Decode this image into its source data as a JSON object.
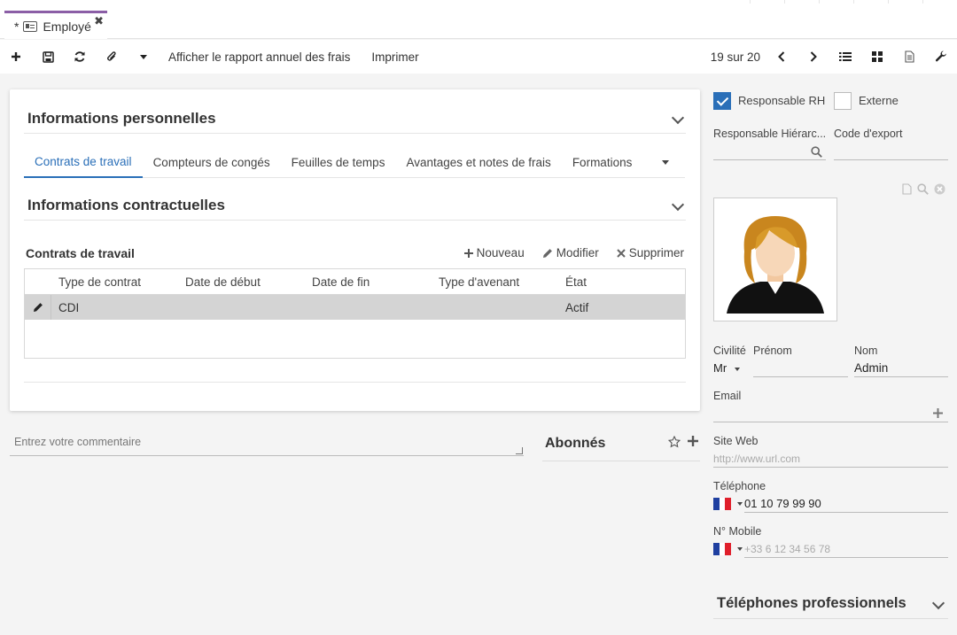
{
  "tab": {
    "dirty_marker": "*",
    "title": "Employé"
  },
  "toolbar": {
    "report_label": "Afficher le rapport annuel des frais",
    "print_label": "Imprimer",
    "pager": "19 sur 20"
  },
  "personal": {
    "title": "Informations personnelles"
  },
  "subtabs": [
    {
      "label": "Contrats de travail"
    },
    {
      "label": "Compteurs de congés"
    },
    {
      "label": "Feuilles de temps"
    },
    {
      "label": "Avantages et notes de frais"
    },
    {
      "label": "Formations"
    }
  ],
  "contractual": {
    "title": "Informations contractuelles"
  },
  "contracts_grid": {
    "title": "Contrats de travail",
    "actions": {
      "new": "Nouveau",
      "edit": "Modifier",
      "delete": "Supprimer"
    },
    "columns": [
      "Type de contrat",
      "Date de début",
      "Date de fin",
      "Type d'avenant",
      "État"
    ],
    "rows": [
      [
        "CDI",
        "",
        "",
        "",
        "Actif"
      ]
    ]
  },
  "comment": {
    "placeholder": "Entrez votre commentaire"
  },
  "followers": {
    "title": "Abonnés"
  },
  "right_panel": {
    "hr_manager_label": "Responsable RH",
    "hr_manager_checked": true,
    "external_label": "Externe",
    "external_checked": false,
    "hierarchical_label": "Responsable Hiérarc...",
    "export_code_label": "Code d'export",
    "civility_label": "Civilité",
    "civility_value": "Mr",
    "firstname_label": "Prénom",
    "firstname_value": "",
    "lastname_label": "Nom",
    "lastname_value": "Admin",
    "email_label": "Email",
    "website_label": "Site Web",
    "website_placeholder": "http://www.url.com",
    "phone_label": "Téléphone",
    "phone_value": "01 10 79 99 90",
    "mobile_label": "N° Mobile",
    "mobile_placeholder": "+33 6 12 34 56 78",
    "pro_phones_title": "Téléphones professionnels"
  },
  "colors": {
    "accent": "#2a6fb8",
    "tab_accent": "#8b5ea6",
    "selected_row": "#d4d4d4"
  }
}
